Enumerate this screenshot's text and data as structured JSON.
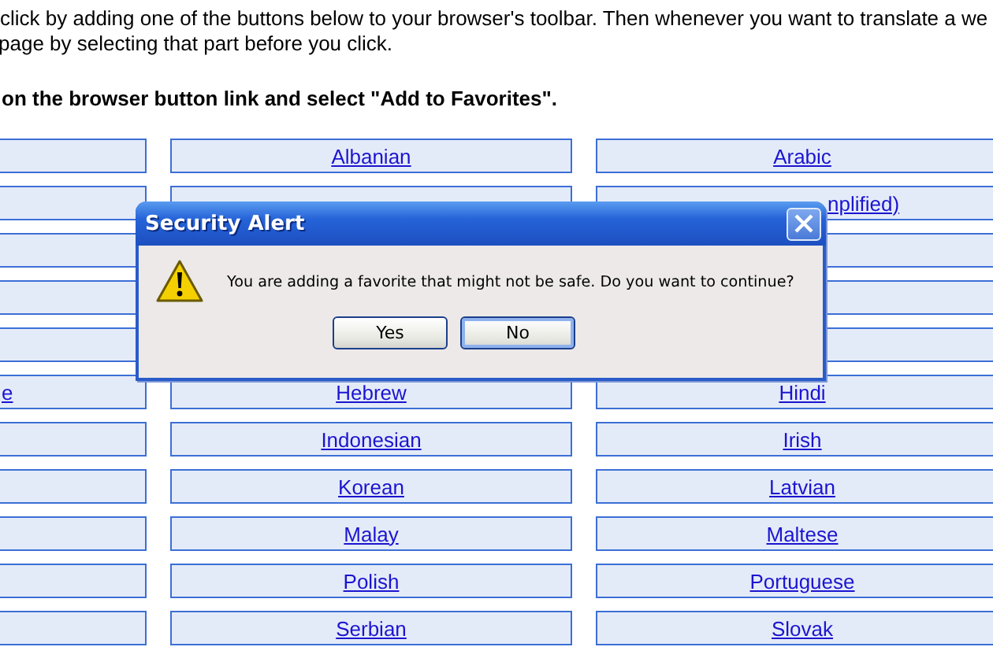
{
  "intro_lines": [
    " click by adding one of the buttons below to your browser's toolbar. Then whenever you want to translate a we",
    "page by selecting that part before you click."
  ],
  "instruction": "on the browser button link and select \"Add to Favorites\".",
  "languages": [
    {
      "cells": [
        {},
        {
          "text": "Albanian"
        },
        {
          "text": "Arabic"
        }
      ]
    },
    {
      "cells": [
        {},
        {},
        {
          "text": "nplified)",
          "kind": "cut_left"
        }
      ]
    },
    {
      "cells": [
        {},
        null,
        {}
      ]
    },
    {
      "cells": [
        {},
        null,
        {}
      ]
    },
    {
      "cells": [
        {},
        null,
        {}
      ]
    },
    {
      "cells": [
        {
          "text": "e",
          "kind": "cut_left"
        },
        {
          "text": "Hebrew"
        },
        {
          "text": "Hindi"
        }
      ]
    },
    {
      "cells": [
        {},
        {
          "text": "Indonesian"
        },
        {
          "text": "Irish"
        }
      ]
    },
    {
      "cells": [
        {},
        {
          "text": "Korean"
        },
        {
          "text": "Latvian"
        }
      ]
    },
    {
      "cells": [
        {},
        {
          "text": "Malay"
        },
        {
          "text": "Maltese"
        }
      ]
    },
    {
      "cells": [
        {},
        {
          "text": "Polish"
        },
        {
          "text": "Portuguese"
        }
      ]
    },
    {
      "cells": [
        {},
        {
          "text": "Serbian"
        },
        {
          "text": "Slovak"
        }
      ]
    }
  ],
  "dialog": {
    "title": "Security Alert",
    "message": "You are adding a favorite that might not be safe.  Do you want to continue?",
    "buttons": [
      {
        "label": "Yes",
        "selected": false
      },
      {
        "label": "No",
        "selected": true
      }
    ]
  }
}
